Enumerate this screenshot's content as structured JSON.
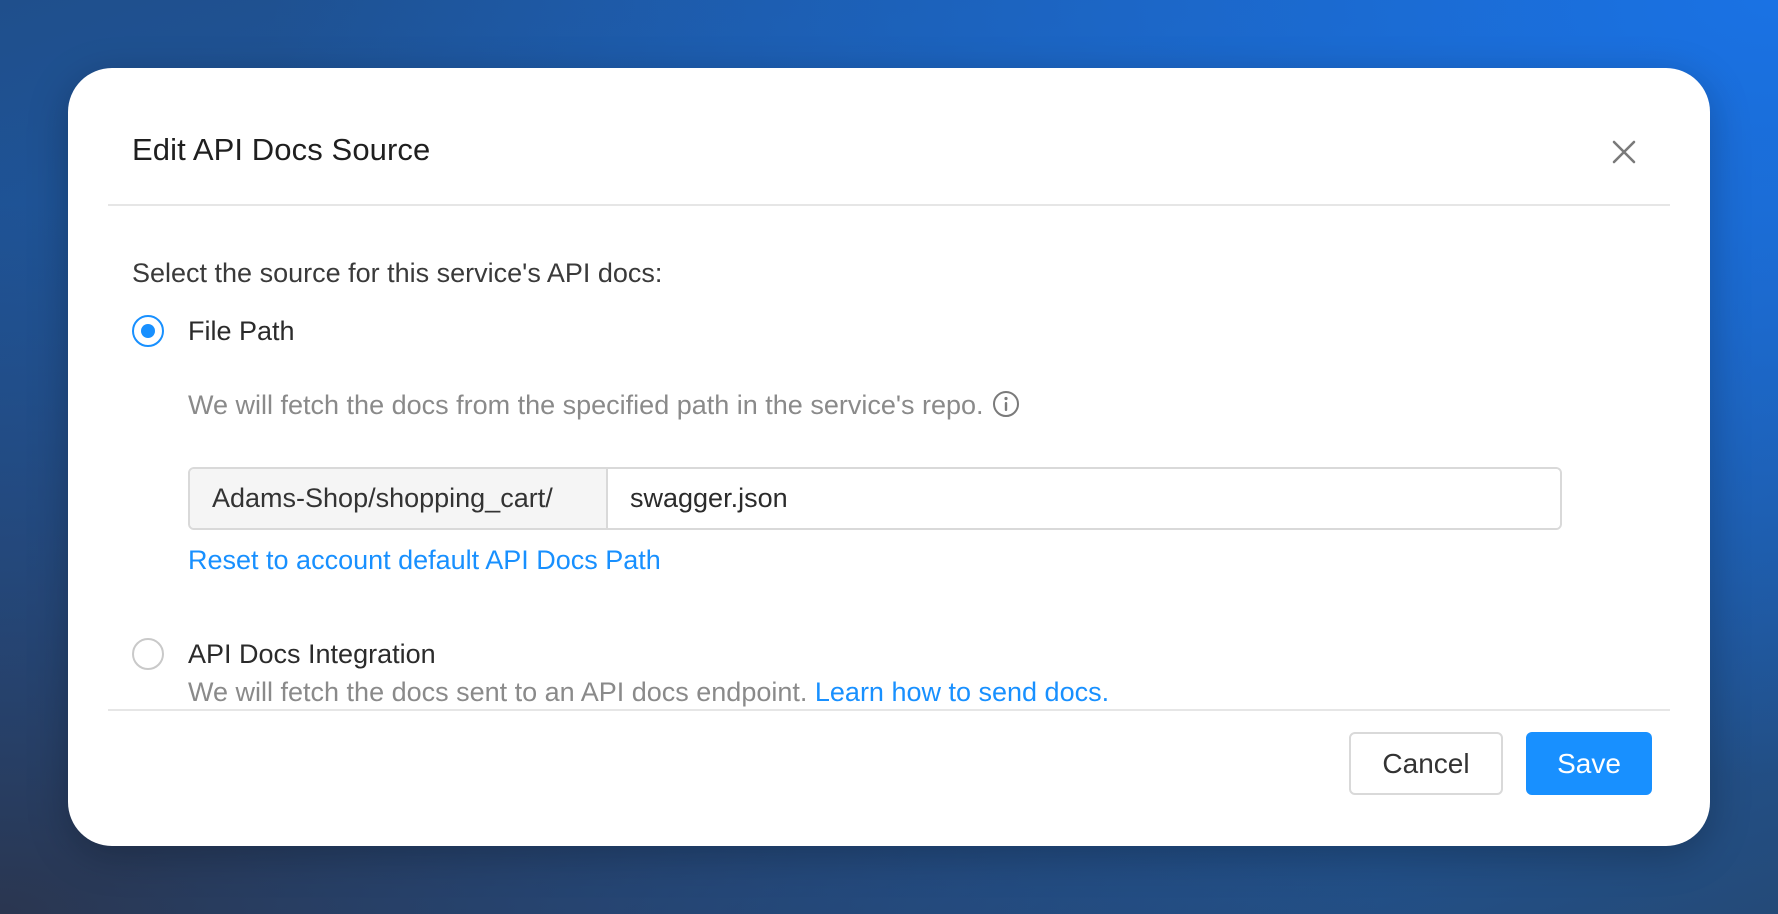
{
  "dialog": {
    "title": "Edit API Docs Source",
    "prompt": "Select the source for this service's API docs:",
    "options": [
      {
        "label": "File Path",
        "selected": true,
        "description": "We will fetch the docs from the specified path in the service's repo.",
        "path_prefix": "Adams-Shop/shopping_cart/",
        "path_value": "swagger.json",
        "reset_link": "Reset to account default API Docs Path"
      },
      {
        "label": "API Docs Integration",
        "selected": false,
        "description": "We will fetch the docs sent to an API docs endpoint.",
        "link": "Learn how to send docs."
      }
    ],
    "cancel_label": "Cancel",
    "save_label": "Save"
  },
  "icons": {
    "close": "close-icon",
    "info": "info-icon"
  },
  "colors": {
    "accent": "#1890ff",
    "text_muted": "#8a8a8a",
    "border": "#d9d9d9"
  }
}
